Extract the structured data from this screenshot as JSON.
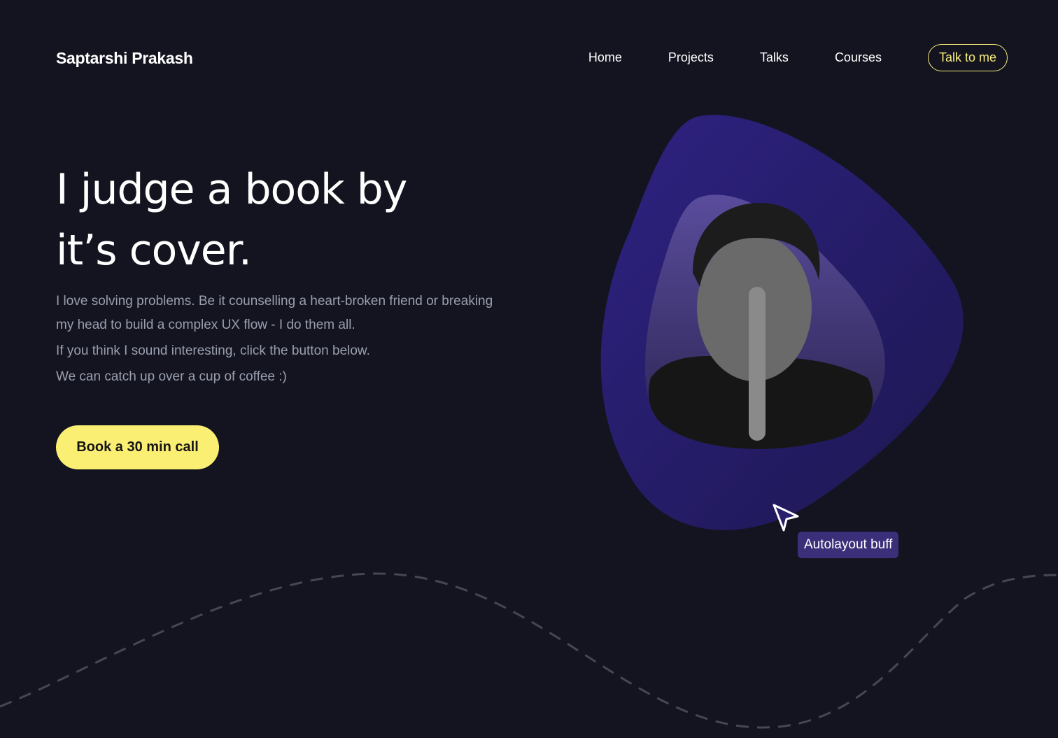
{
  "header": {
    "logo": "Saptarshi Prakash",
    "nav": [
      {
        "label": "Home"
      },
      {
        "label": "Projects"
      },
      {
        "label": "Talks"
      },
      {
        "label": "Courses"
      }
    ],
    "cta": "Talk to me"
  },
  "hero": {
    "title_line1": "I judge a book by",
    "title_line2": "it’s cover.",
    "intro": [
      "I love solving problems. Be it counselling a heart-broken friend or breaking my head to build a complex UX flow - I do them all.",
      "If you think I sound interesting, click the button below.",
      "We can catch up over a cup of coffee :)"
    ],
    "book_button": "Book a 30 min call",
    "tooltip": "Autolayout buff"
  },
  "colors": {
    "background": "#13141f",
    "accent": "#fbef73",
    "blob": "#2a1f6e",
    "tooltip": "#3b2f7a"
  }
}
